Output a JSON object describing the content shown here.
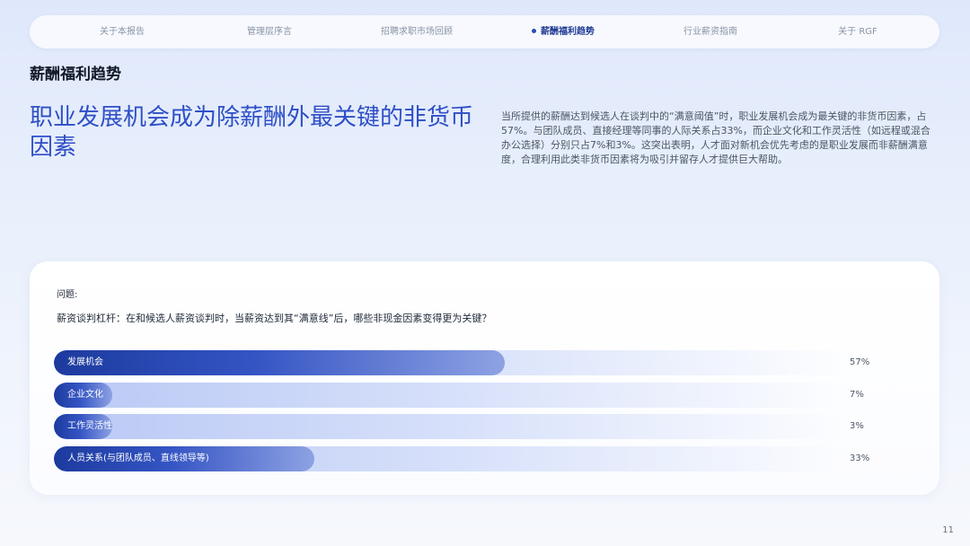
{
  "nav": {
    "items": [
      {
        "label": "关于本报告",
        "active": false
      },
      {
        "label": "管理层序言",
        "active": false
      },
      {
        "label": "招聘求职市场回顾",
        "active": false
      },
      {
        "label": "薪酬福利趋势",
        "active": true
      },
      {
        "label": "行业薪资指南",
        "active": false
      },
      {
        "label": "关于 RGF",
        "active": false
      }
    ]
  },
  "section_title": "薪酬福利趋势",
  "headline": "职业发展机会成为除薪酬外最关键的非货币因素",
  "description": "当所提供的薪酬达到候选人在谈判中的“满意阈值”时，职业发展机会成为最关键的非货币因素，占57%。与团队成员、直接经理等同事的人际关系占33%，而企业文化和工作灵活性（如远程或混合办公选择）分别只占7%和3%。这突出表明，人才面对新机会优先考虑的是职业发展而非薪酬满意度，合理利用此类非货币因素将为吸引并留存人才提供巨大帮助。",
  "question": {
    "label": "问题:",
    "text": "薪资谈判杠杆：在和候选人薪资谈判时，当薪资达到其“满意线”后，哪些非现金因素变得更为关键？"
  },
  "chart_data": {
    "type": "bar",
    "orientation": "horizontal",
    "categories": [
      "发展机会",
      "企业文化",
      "工作灵活性",
      "人员关系(与团队成员、直线领导等)"
    ],
    "values": [
      57,
      7,
      3,
      33
    ],
    "value_labels": [
      "57%",
      "7%",
      "3%",
      "33%"
    ],
    "unit": "%",
    "xlim": [
      0,
      100
    ],
    "colors": {
      "fill_start": "#1c3a9e",
      "fill_end": "#8ea2e3",
      "track": "#d6e0fa"
    }
  },
  "page_number": "11"
}
